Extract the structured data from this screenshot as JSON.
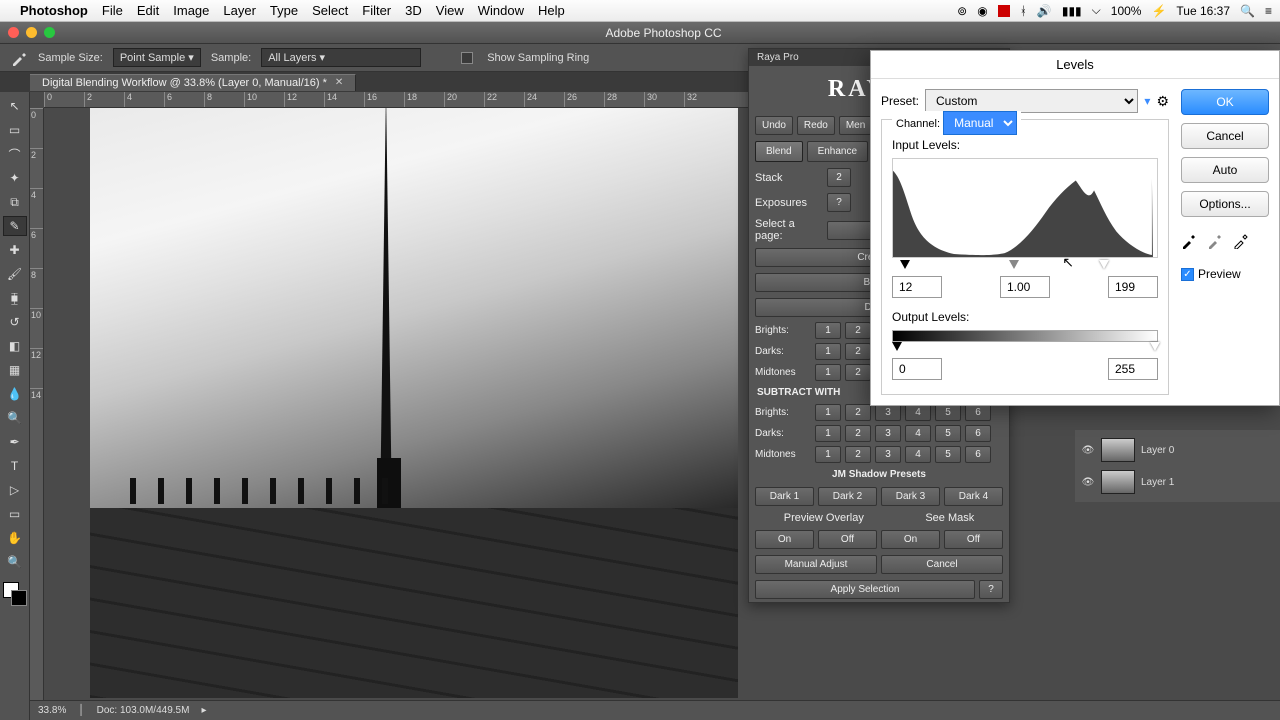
{
  "menubar": {
    "app": "Photoshop",
    "items": [
      "File",
      "Edit",
      "Image",
      "Layer",
      "Type",
      "Select",
      "Filter",
      "3D",
      "View",
      "Window",
      "Help"
    ],
    "battery": "100%",
    "clock": "Tue 16:37"
  },
  "window": {
    "title": "Adobe Photoshop CC"
  },
  "optionsBar": {
    "sampleSizeLabel": "Sample Size:",
    "sampleSizeValue": "Point Sample",
    "sampleLabel": "Sample:",
    "sampleValue": "All Layers",
    "showSamplingRing": "Show Sampling Ring"
  },
  "documentTab": {
    "title": "Digital Blending Workflow @ 33.8% (Layer 0, Manual/16) *"
  },
  "rulerMarks": [
    "0",
    "2",
    "4",
    "6",
    "8",
    "10",
    "12",
    "14",
    "16",
    "18",
    "20",
    "22",
    "24",
    "26",
    "28",
    "30",
    "32"
  ],
  "rulerMarksV": [
    "0",
    "2",
    "4",
    "6",
    "8",
    "10",
    "12",
    "14"
  ],
  "statusBar": {
    "zoom": "33.8%",
    "docSize": "Doc: 103.0M/449.5M"
  },
  "rayaPro": {
    "panelTitle": "Raya Pro",
    "logo": "RAYA P",
    "undo": "Undo",
    "redo": "Redo",
    "menu": "Men",
    "tabs": [
      "Blend",
      "Enhance"
    ],
    "stackLabel": "Stack",
    "exposuresLabel": "Exposures",
    "stackBtns": [
      "2"
    ],
    "expBtns": [
      "?"
    ],
    "selectPage": "Select a page:",
    "createAll": "Create All",
    "brights": "Brights",
    "delete": "Delete",
    "rowLabels": [
      "Brights:",
      "Darks:",
      "Midtones"
    ],
    "rowLabels2": [
      "Brights:",
      "Darks:",
      "Midtones"
    ],
    "subtractWith": "SUBTRACT WITH",
    "nums": [
      "1",
      "2",
      "3",
      "4",
      "5",
      "6"
    ],
    "jmShadowPresets": "JM Shadow Presets",
    "darkPresets": [
      "Dark 1",
      "Dark 2",
      "Dark 3",
      "Dark 4"
    ],
    "previewOverlay": "Preview Overlay",
    "seeMask": "See Mask",
    "on": "On",
    "off": "Off",
    "manualAdjust": "Manual Adjust",
    "cancel": "Cancel",
    "applySelection": "Apply Selection",
    "help": "?"
  },
  "levels": {
    "title": "Levels",
    "presetLabel": "Preset:",
    "presetValue": "Custom",
    "channelLabel": "Channel:",
    "channelValue": "Manual",
    "inputLevelsLabel": "Input Levels:",
    "outputLevelsLabel": "Output Levels:",
    "inBlack": "12",
    "inGamma": "1.00",
    "inWhite": "199",
    "outBlack": "0",
    "outWhite": "255",
    "ok": "OK",
    "cancel": "Cancel",
    "auto": "Auto",
    "options": "Options...",
    "preview": "Preview"
  },
  "layers": {
    "layer0": "Layer 0",
    "layer1": "Layer 1"
  }
}
